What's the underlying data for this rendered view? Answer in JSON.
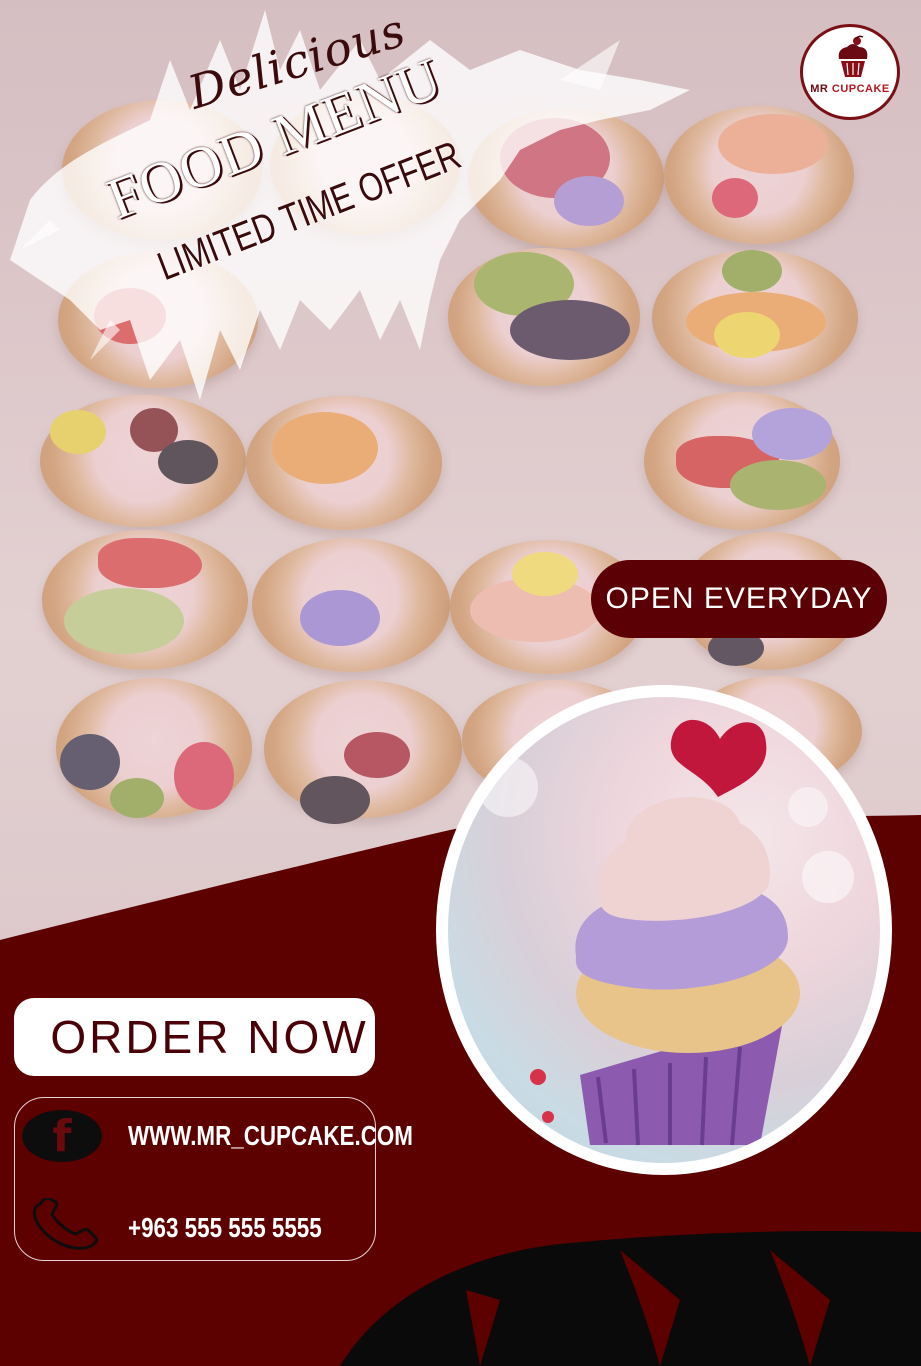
{
  "header": {
    "script_title": "Delicious",
    "main_title": "FOOD MENU",
    "subtitle": "LIMITED TIME OFFER"
  },
  "brand": {
    "logo_text_1": "MR",
    "logo_text_2": "CUPCAKE",
    "logo_icon": "cupcake-icon"
  },
  "badge": {
    "open_label": "OPEN EVERYDAY"
  },
  "cta": {
    "order_label": "ORDER NOW"
  },
  "contact": {
    "website": "WWW.MR_CUPCAKE.COM",
    "phone": "+963 555 555 5555",
    "website_icon": "facebook-icon",
    "phone_icon": "phone-icon"
  },
  "colors": {
    "primary": "#5c0000",
    "dark": "#0d0d0d",
    "light": "#ffffff",
    "accent": "#6b0a12"
  }
}
